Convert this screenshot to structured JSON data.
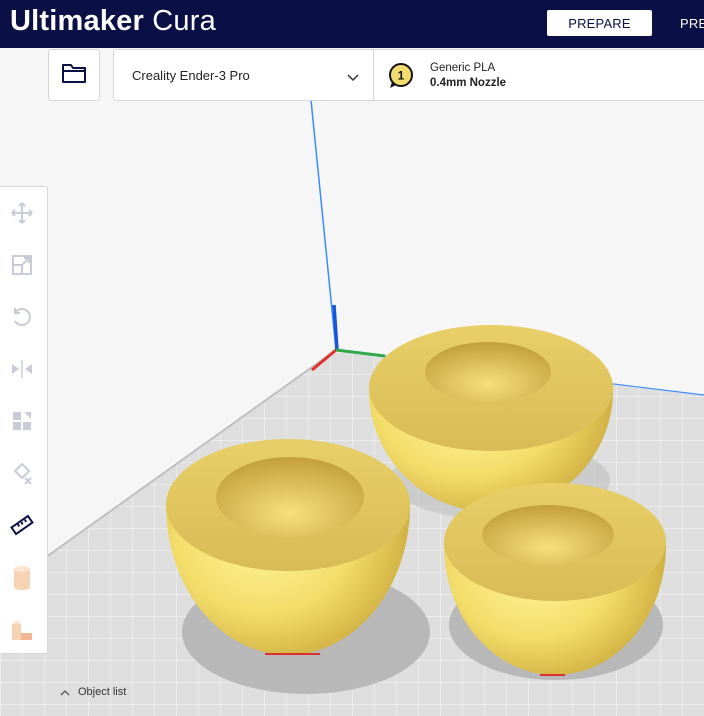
{
  "app": {
    "brand_bold": "Ultimaker",
    "brand_light": "Cura"
  },
  "stages": {
    "active": "PREPARE",
    "next": "PREVIEW"
  },
  "printer": {
    "name": "Creality Ender-3 Pro"
  },
  "extruder": {
    "number": "1",
    "material": "Generic PLA",
    "nozzle": "0.4mm Nozzle"
  },
  "tools": [
    "move",
    "scale",
    "rotate",
    "mirror",
    "per-model-settings",
    "support-blocker",
    "measure",
    "model-1",
    "model-2"
  ],
  "object_list": {
    "label": "Object list"
  },
  "colors": {
    "header": "#0a1046",
    "model": "#f2dc6e",
    "accent": "#3282ff"
  }
}
